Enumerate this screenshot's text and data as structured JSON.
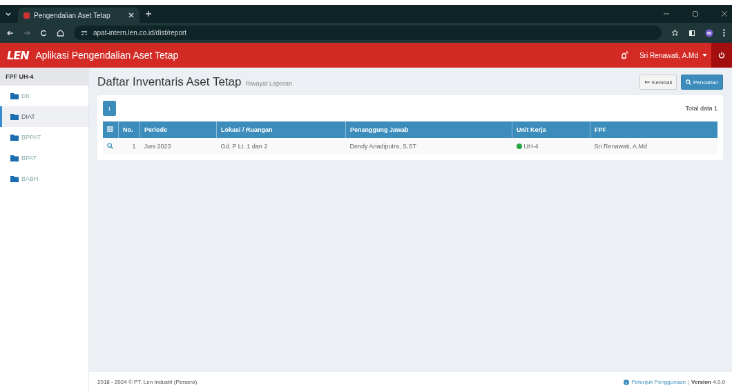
{
  "browser": {
    "tab_title": "Pengendalian Aset Tetap",
    "url": "apat-intern.len.co.id/dist/report"
  },
  "header": {
    "logo": "LEN",
    "title": "Aplikasi Pengendalian Aset Tetap",
    "user": "Sri Renawati, A.Md"
  },
  "sidebar": {
    "heading": "FPF UH-4",
    "items": [
      {
        "label": "DII",
        "selected": false
      },
      {
        "label": "DIAT",
        "selected": true
      },
      {
        "label": "BPPAT",
        "selected": false
      },
      {
        "label": "BPAT",
        "selected": false
      },
      {
        "label": "BABH",
        "selected": false
      }
    ]
  },
  "page": {
    "title": "Daftar Inventaris Aset Tetap",
    "subtitle": "Riwayat Laporan",
    "buttons": [
      {
        "label": "Kembali",
        "kind": "back"
      },
      {
        "label": "Pencarian",
        "kind": "search"
      }
    ]
  },
  "pagination": [
    {
      "label": "1",
      "selected": true
    }
  ],
  "total": "Total data 1",
  "table": {
    "columns": [
      "No.",
      "Periode",
      "Lokasi / Ruangan",
      "Penanggung Jawab",
      "Unit Kerja",
      "FPF"
    ],
    "rows": [
      {
        "cells": [
          "1",
          "Juni 2023",
          "Gd. P Lt. 1 dan 2",
          "Dendy Ariadiputra, S.ST",
          "UH-4",
          "Sri Renawati, A.Md"
        ],
        "color": "#28a745"
      }
    ]
  },
  "footer": {
    "copyright": "2018 - 2024 © PT. Len Industri (Persero)",
    "link": "Petunjuk Penggunaan",
    "separator": "|",
    "version": "**Version** 4.0.0"
  }
}
